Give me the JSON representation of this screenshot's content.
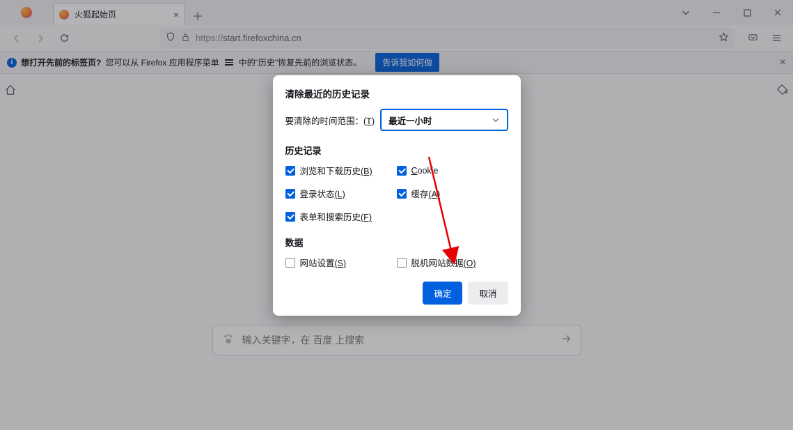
{
  "tabstrip": {
    "tab_title": "火狐起始页"
  },
  "toolbar": {
    "url": "https://start.firefoxchina.cn",
    "url_proto": "https://",
    "url_rest": "start.firefoxchina.cn"
  },
  "infobar": {
    "strong": "想打开先前的标签页?",
    "part1": "您可以从 Firefox 应用程序菜单",
    "part2": "中的\"历史\"恢复先前的浏览状态。",
    "button": "告诉我如何做"
  },
  "page": {
    "search_placeholder": "输入关键字，在 百度 上搜索"
  },
  "dialog": {
    "title": "清除最近的历史记录",
    "range_label_pre": "要清除的时间范围：",
    "range_key": "(T)",
    "range_value": "最近一小时",
    "section_history": "历史记录",
    "checks": {
      "browse": {
        "label": "浏览和下载历史",
        "key": "(B)",
        "checked": true
      },
      "cookie": {
        "label": "Cookie",
        "key": "",
        "checked": true
      },
      "login": {
        "label": "登录状态",
        "key": "(L)",
        "checked": true
      },
      "cache": {
        "label": "缓存",
        "key": "(A)",
        "checked": true
      },
      "forms": {
        "label": "表单和搜索历史",
        "key": "(F)",
        "checked": true
      }
    },
    "section_data": "数据",
    "data_checks": {
      "site": {
        "label": "网站设置",
        "key": "(S)",
        "checked": false
      },
      "offline": {
        "label": "脱机网站数据",
        "key": "(O)",
        "checked": false
      }
    },
    "ok": "确定",
    "cancel": "取消"
  }
}
